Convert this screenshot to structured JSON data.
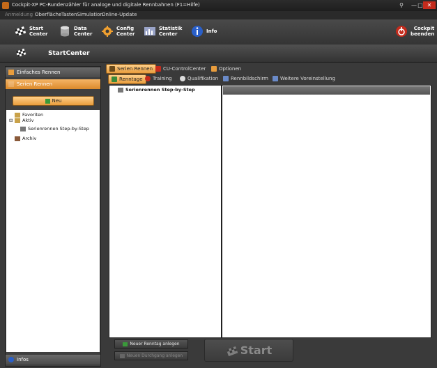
{
  "window": {
    "title": "Cockpit-XP PC-Rundenzähler für analoge und digitale Rennbahnen (F1=Hilfe)",
    "minimize": "—",
    "maximize": "□",
    "close": "✕"
  },
  "menu": [
    "Anmeldung",
    "Oberfläche",
    "TastenSimulation",
    "Online-Update"
  ],
  "toolbar": {
    "start": "Start\nCenter",
    "data": "Data\nCenter",
    "config": "Config\nCenter",
    "stat": "Statistik\nCenter",
    "info": "Info",
    "quit": "Cockpit\nbeenden"
  },
  "section": {
    "title": "StartCenter"
  },
  "left": {
    "acc1": "Einfaches Rennen",
    "acc2": "Serien Rennen",
    "new_button": "Neu",
    "tree": [
      "Favoriten",
      "Aktiv",
      "Serienrennen Step-by-Step",
      "Archiv"
    ],
    "infos": "Infos"
  },
  "tabs_top": [
    "Serien Rennen",
    "CU-ControlCenter",
    "Optionen"
  ],
  "tabs_sub": [
    "Renntage",
    "Training",
    "Qualifikation",
    "Rennbildschirm",
    "Weitere Voreinstellung"
  ],
  "list": {
    "item": "Serienrennen Step-by-Step"
  },
  "bottom": {
    "new_day": "Neuer Renntag anlegen",
    "new_run": "Neuen Durchgang anlegen",
    "start": "Start"
  },
  "colors": {
    "accent": "#e99d3d",
    "background": "#3a3a3a"
  }
}
